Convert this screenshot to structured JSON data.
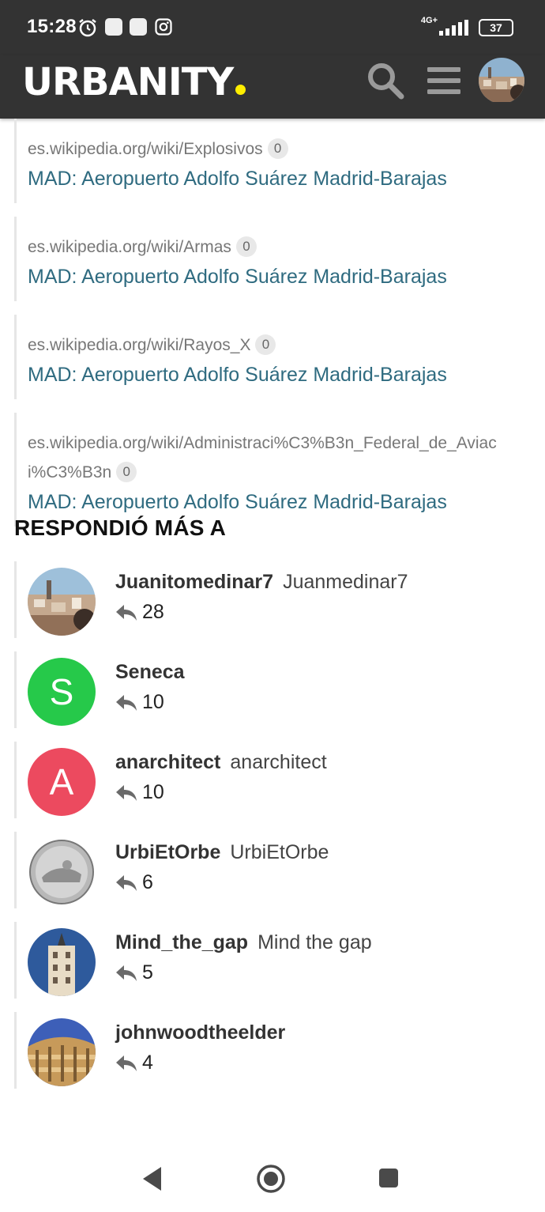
{
  "status": {
    "time": "15:28",
    "network": "4G+",
    "battery": "37"
  },
  "header": {
    "logo": "URBANITY",
    "accent_color": "#ffee00"
  },
  "links": [
    {
      "url": "es.wikipedia.org/wiki/Explosivos",
      "count": "0",
      "title": "MAD: Aeropuerto Adolfo Suárez Madrid-Barajas"
    },
    {
      "url": "es.wikipedia.org/wiki/Armas",
      "count": "0",
      "title": "MAD: Aeropuerto Adolfo Suárez Madrid-Barajas"
    },
    {
      "url": "es.wikipedia.org/wiki/Rayos_X",
      "count": "0",
      "title": "MAD: Aeropuerto Adolfo Suárez Madrid-Barajas"
    },
    {
      "url": "es.wikipedia.org/wiki/Administraci%C3%B3n_Federal_de_Aviaci%C3%B3n",
      "count": "0",
      "title": "MAD: Aeropuerto Adolfo Suárez Madrid-Barajas"
    }
  ],
  "section": {
    "title": "RESPONDIÓ MÁS A"
  },
  "users": [
    {
      "username": "Juanitomedinar7",
      "name": "Juanmedinar7",
      "replies": "28",
      "avatar": "photo"
    },
    {
      "username": "Seneca",
      "name": "",
      "replies": "10",
      "avatar": "letter",
      "letter": "S",
      "color": "#26c94a"
    },
    {
      "username": "anarchitect",
      "name": "anarchitect",
      "replies": "10",
      "avatar": "letter",
      "letter": "A",
      "color": "#ec4a5f"
    },
    {
      "username": "UrbiEtOrbe",
      "name": "UrbiEtOrbe",
      "replies": "6",
      "avatar": "coin"
    },
    {
      "username": "Mind_the_gap",
      "name": "Mind the gap",
      "replies": "5",
      "avatar": "building"
    },
    {
      "username": "johnwoodtheelder",
      "name": "",
      "replies": "4",
      "avatar": "crescent"
    }
  ]
}
